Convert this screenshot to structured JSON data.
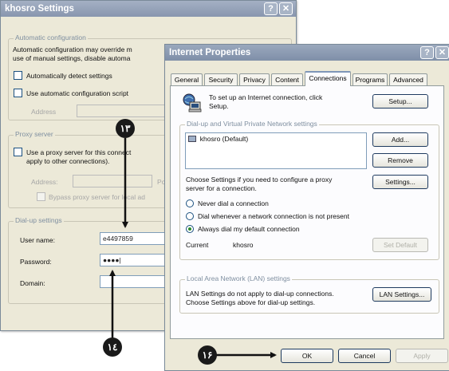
{
  "back_dialog": {
    "title": "khosro Settings",
    "help_label": "?",
    "close_label": "✕",
    "auto_config": {
      "group_label": "Automatic configuration",
      "desc_line1": "Automatic configuration may override m",
      "desc_line2": "use of manual settings, disable automa",
      "detect_label": "Automatically detect settings",
      "script_label": "Use automatic configuration script",
      "address_label": "Address"
    },
    "proxy": {
      "group_label": "Proxy server",
      "use_line1": "Use a proxy server for this connect",
      "use_line2": "apply to other connections).",
      "address_label": "Address:",
      "port_label": "Po",
      "bypass_label": "Bypass proxy server for local ad"
    },
    "dialup": {
      "group_label": "Dial-up settings",
      "user_label": "User name:",
      "user_value": "e4497859",
      "password_label": "Password:",
      "password_value": "●●●●|",
      "domain_label": "Domain:",
      "domain_value": ""
    }
  },
  "front_dialog": {
    "title": "Internet Properties",
    "help_label": "?",
    "close_label": "✕",
    "tabs": [
      "General",
      "Security",
      "Privacy",
      "Content",
      "Connections",
      "Programs",
      "Advanced"
    ],
    "active_tab": "Connections",
    "setup_line1": "To set up an Internet connection, click",
    "setup_line2": "Setup.",
    "setup_button": "Setup...",
    "dialup_vpn_group": "Dial-up and Virtual Private Network settings",
    "connections": [
      "khosro (Default)"
    ],
    "add_button": "Add...",
    "remove_button": "Remove",
    "settings_button": "Settings...",
    "proxy_line1": "Choose Settings if you need to configure a proxy",
    "proxy_line2": "server for a connection.",
    "radio_options": [
      "Never dial a connection",
      "Dial whenever a network connection is not present",
      "Always dial my default connection"
    ],
    "current_label": "Current",
    "current_value": "khosro",
    "set_default_button": "Set Default",
    "lan_group": "Local Area Network (LAN) settings",
    "lan_line1": "LAN Settings do not apply to dial-up connections.",
    "lan_line2": "Choose Settings above for dial-up settings.",
    "lan_button": "LAN Settings...",
    "ok_button": "OK",
    "cancel_button": "Cancel",
    "apply_button": "Apply"
  },
  "callouts": {
    "c13": "١٣",
    "c14": "١٤",
    "c16": "١۶"
  }
}
